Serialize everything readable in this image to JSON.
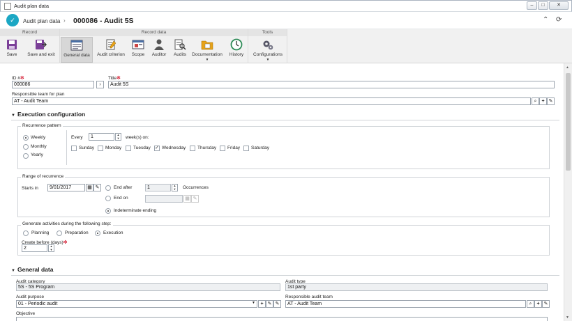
{
  "window": {
    "title": "Audit plan data"
  },
  "header": {
    "crumb1": "Audit plan data",
    "crumb2": "000086 - Audit 5S"
  },
  "ribbon": {
    "groups": {
      "record": "Record",
      "record_data": "Record data",
      "tools": "Tools"
    },
    "save": "Save",
    "save_exit": "Save and exit",
    "general_data": "General data",
    "audit_criterion": "Audit criterion",
    "scope": "Scope",
    "auditor": "Auditor",
    "audits": "Audits",
    "documentation": "Documentation",
    "history": "History",
    "configurations": "Configurations"
  },
  "form": {
    "id_label": "ID #",
    "id_value": "000086",
    "title_label": "Title",
    "title_value": "Audit 5S",
    "resp_team_label": "Responsible team for plan",
    "resp_team_value": "AT - Audit Team"
  },
  "execution": {
    "heading": "Execution configuration",
    "recurrence_legend": "Recurrence pattern",
    "weekly": "Weekly",
    "monthly": "Monthly",
    "yearly": "Yearly",
    "every": "Every",
    "every_value": "1",
    "weeks_on": "week(s) on:",
    "days": [
      "Sunday",
      "Monday",
      "Tuesday",
      "Wednesday",
      "Thursday",
      "Friday",
      "Saturday"
    ],
    "range_legend": "Range of recurrence",
    "starts_in": "Starts in",
    "start_date": "9/01/2017",
    "end_after": "End after",
    "end_after_value": "1",
    "occurrences": "Occurrences",
    "end_on": "End on",
    "indeterminate": "Indeterminate ending",
    "generate_legend": "Generate activities during the following step:",
    "planning": "Planning",
    "preparation": "Preparation",
    "execution_opt": "Execution",
    "create_before": "Create before (days)",
    "create_before_value": "2"
  },
  "general": {
    "heading": "General data",
    "category_label": "Audit category",
    "category_value": "5S - 5S Program",
    "type_label": "Audit type",
    "type_value": "1st party",
    "purpose_label": "Audit purpose",
    "purpose_value": "01 - Periodic audit",
    "resp_audit_team_label": "Responsible audit team",
    "resp_audit_team_value": "AT - Audit Team",
    "objective_label": "Objective"
  },
  "colors": {
    "accent": "#1ba7c4",
    "required": "#d0021b"
  }
}
